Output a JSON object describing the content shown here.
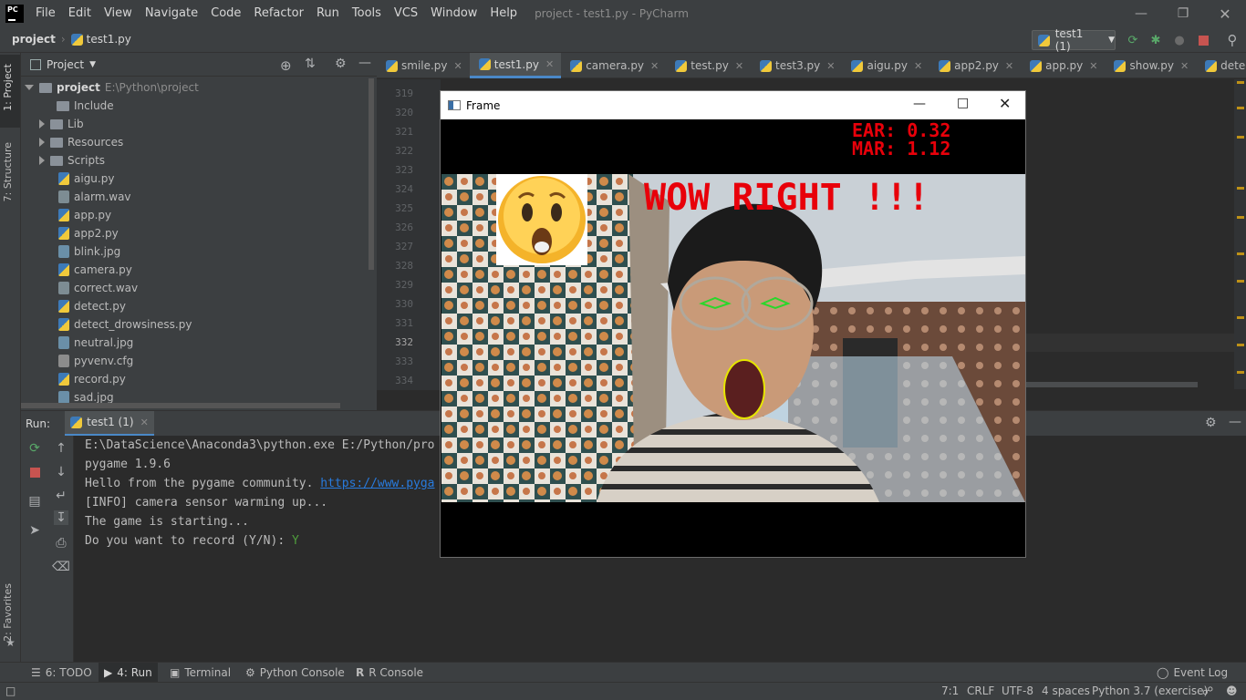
{
  "app": {
    "window_title": "project - test1.py - PyCharm",
    "logo_text": "PC",
    "menu": [
      "File",
      "Edit",
      "View",
      "Navigate",
      "Code",
      "Refactor",
      "Run",
      "Tools",
      "VCS",
      "Window",
      "Help"
    ]
  },
  "navbar": {
    "project": "project",
    "file": "test1.py",
    "run_config": "test1 (1)"
  },
  "project_panel": {
    "title": "Project",
    "root_name": "project",
    "root_path": "E:\\Python\\project",
    "folders": [
      "Include",
      "Lib",
      "Resources",
      "Scripts"
    ],
    "files": [
      "aigu.py",
      "alarm.wav",
      "app.py",
      "app2.py",
      "blink.jpg",
      "camera.py",
      "correct.wav",
      "detect.py",
      "detect_drowsiness.py",
      "neutral.jpg",
      "pyvenv.cfg",
      "record.py",
      "sad.jpg"
    ]
  },
  "left_strip": {
    "project_tab": "1: Project",
    "structure_tab": "7: Structure",
    "favorites_tab": "2: Favorites"
  },
  "editor": {
    "tabs": [
      "smile.py",
      "test1.py",
      "camera.py",
      "test.py",
      "test3.py",
      "aigu.py",
      "app2.py",
      "app.py",
      "show.py",
      "detect.py"
    ],
    "active_tab": "test1.py",
    "line_numbers": [
      "319",
      "320",
      "321",
      "322",
      "323",
      "324",
      "325",
      "326",
      "327",
      "328",
      "329",
      "330",
      "331",
      "332",
      "333",
      "334"
    ],
    "current_line": "332"
  },
  "frame_window": {
    "title": "Frame",
    "ear": "EAR: 0.32",
    "mar": "MAR: 1.12",
    "overlay_text": "WOW RIGHT !!!"
  },
  "run_panel": {
    "label": "Run:",
    "tab": "test1 (1)",
    "console_lines": [
      "E:\\DataScience\\Anaconda3\\python.exe E:/Python/pro",
      "pygame 1.9.6",
      "[INFO] camera sensor warming up...",
      "The game is starting..."
    ],
    "hello_prefix": "Hello from the pygame community. ",
    "hello_link": "https://www.pyga",
    "prompt": "Do you want to record (Y/N): ",
    "prompt_answer": "Y"
  },
  "bottom_tabs": {
    "todo": "6: TODO",
    "run": "4: Run",
    "terminal": "Terminal",
    "python_console": "Python Console",
    "r_console": "R Console",
    "event_log": "Event Log"
  },
  "status_bar": {
    "position": "7:1",
    "line_sep": "CRLF",
    "encoding": "UTF-8",
    "indent": "4 spaces",
    "interpreter": "Python 3.7 (exercise)"
  },
  "colors": {
    "accent": "#4a88c7",
    "overlay_red": "#e8000a",
    "eye_green": "#2bd62b",
    "mouth_yellow": "#e6e600"
  }
}
